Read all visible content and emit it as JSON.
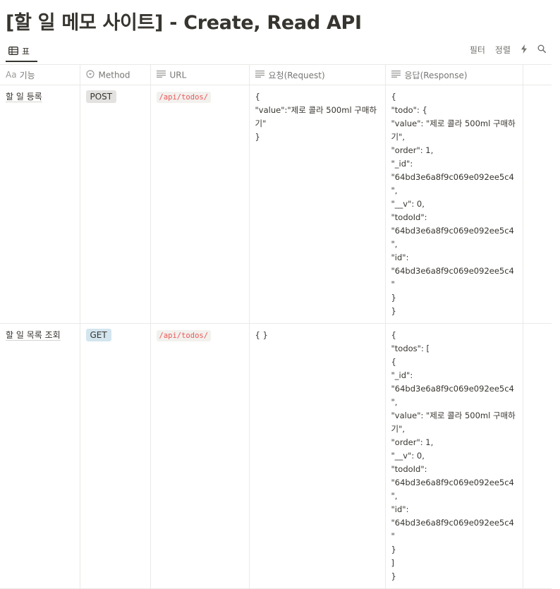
{
  "page": {
    "title": "[할 일 메모 사이트] - Create, Read API"
  },
  "view": {
    "tab_icon": "table-icon",
    "tab_label": "표",
    "actions": {
      "filter": "필터",
      "sort": "정렬",
      "lightning_icon": "lightning-icon",
      "search_icon": "search-icon"
    }
  },
  "table": {
    "columns": [
      {
        "icon": "Aa",
        "label": "기능"
      },
      {
        "icon": "select-icon",
        "label": "Method"
      },
      {
        "icon": "text-lines-icon",
        "label": "URL"
      },
      {
        "icon": "text-lines-icon",
        "label": "요청(Request)"
      },
      {
        "icon": "text-lines-icon",
        "label": "응답(Response)"
      }
    ],
    "rows": [
      {
        "feature": "할 일 등록",
        "method": "POST",
        "method_color": "#e3e2e0",
        "url": "/api/todos/",
        "request": "{\n\"value\":\"제로 콜라 500ml 구매하기\"\n}",
        "response": "{\n\"todo\": {\n\"value\": \"제로 콜라 500ml 구매하기\",\n\"order\": 1,\n\"_id\": \"64bd3e6a8f9c069e092ee5c4\",\n\"__v\": 0,\n\"todoId\": \"64bd3e6a8f9c069e092ee5c4\",\n\"id\": \"64bd3e6a8f9c069e092ee5c4\"\n}\n}"
      },
      {
        "feature": "할 일 목록 조회",
        "method": "GET",
        "method_color": "#d3e5ef",
        "url": "/api/todos/",
        "request": "{ }",
        "response": "{\n\"todos\": [\n{\n\"_id\": \"64bd3e6a8f9c069e092ee5c4\",\n\"value\": \"제로 콜라 500ml 구매하기\",\n\"order\": 1,\n\"__v\": 0,\n\"todoId\": \"64bd3e6a8f9c069e092ee5c4\",\n\"id\": \"64bd3e6a8f9c069e092ee5c4\"\n}\n]\n}"
      }
    ]
  }
}
